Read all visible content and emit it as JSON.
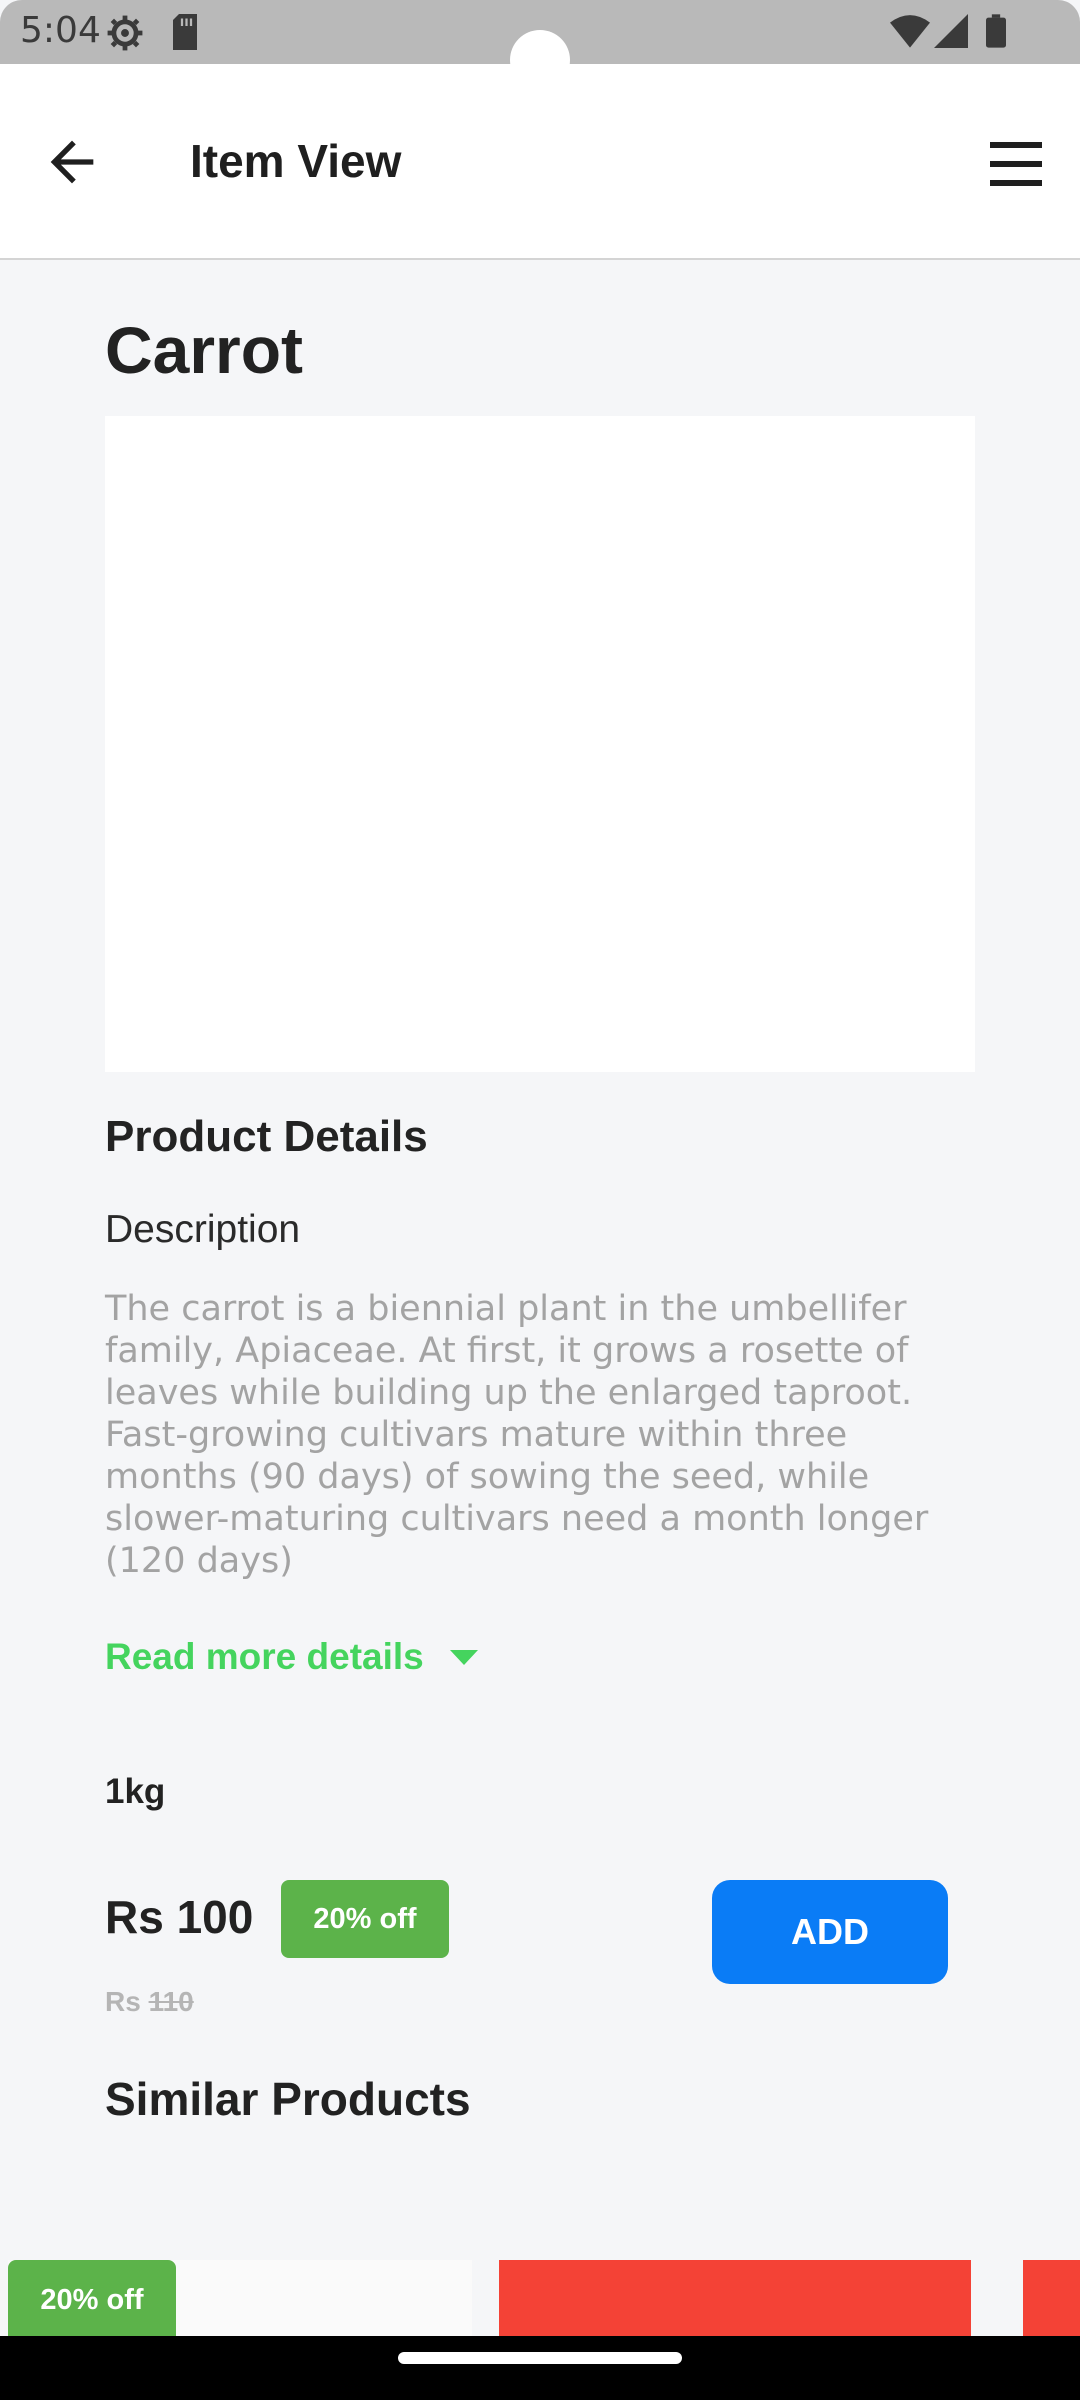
{
  "status_bar": {
    "time": "5:04",
    "icons": [
      "settings-icon",
      "sd-card-icon",
      "wifi-icon",
      "signal-icon",
      "battery-icon"
    ]
  },
  "app_bar": {
    "title": "Item View",
    "back_icon": "arrow-left-icon",
    "menu_icon": "hamburger-menu-icon"
  },
  "product": {
    "name": "Carrot",
    "details_heading": "Product Details",
    "description_label": "Description",
    "description": "The carrot is a biennial plant in the umbellifer family, Apiaceae. At first, it grows a rosette of leaves while building up the enlarged taproot. Fast-growing cultivars mature within three months (90 days) of sowing the seed, while slower-maturing cultivars need a month longer (120 days)",
    "read_more": "Read more details",
    "weight": "1kg",
    "price": "Rs 100",
    "discount": "20% off",
    "old_price_prefix": "Rs",
    "old_price_value": "110",
    "add_label": "ADD"
  },
  "similar": {
    "heading": "Similar Products",
    "cards": [
      {
        "discount": "20% off",
        "color": "#fafafa"
      },
      {
        "color": "#f44236"
      },
      {
        "color": "#f44236"
      }
    ]
  },
  "colors": {
    "accent_blue": "#0a7cf6",
    "discount_green": "#5cb34a",
    "read_more_green": "#45d45e",
    "card_red": "#f44236"
  }
}
